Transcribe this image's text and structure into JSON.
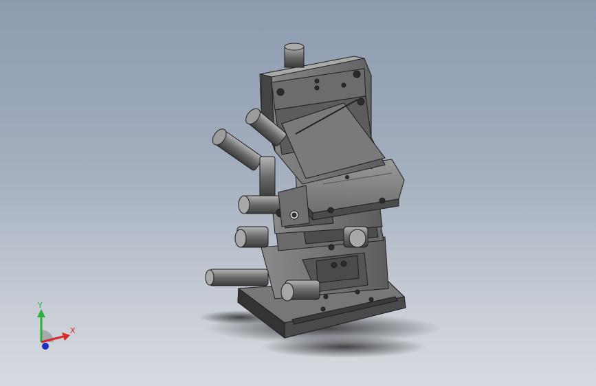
{
  "viewport": {
    "title": "",
    "model_name": "micrometer-xyz-positioning-stage",
    "background_top": "#8d9bb0",
    "background_bottom": "#d7dbe1"
  },
  "triad": {
    "x_label": "X",
    "y_label": "Y",
    "x_color": "#d62828",
    "y_color": "#2fae3a",
    "z_color": "#1d2fbd"
  },
  "model": {
    "body_color": "#6b6b6b",
    "shade_dark": "#3d3d3d",
    "shade_light": "#9a9a9a",
    "icons": [
      "micrometer-knob-icon",
      "screw-hole-icon"
    ]
  }
}
